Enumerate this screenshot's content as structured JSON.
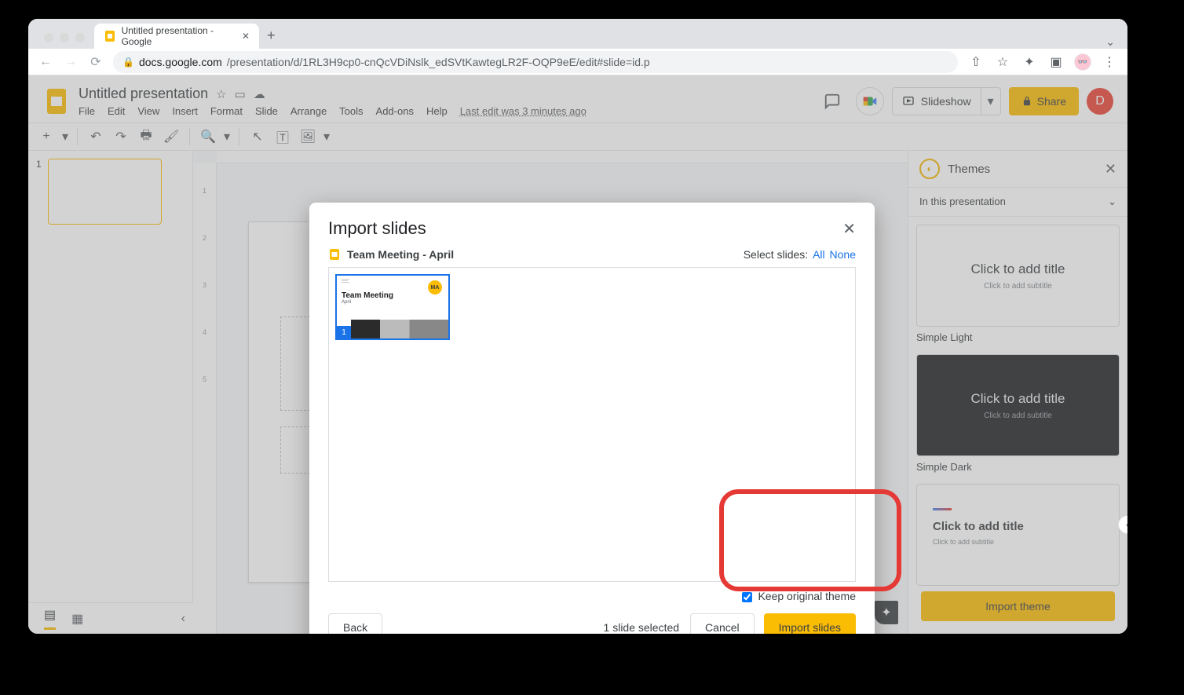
{
  "browser": {
    "tab_title": "Untitled presentation - Google",
    "url_domain": "docs.google.com",
    "url_path": "/presentation/d/1RL3H9cp0-cnQcVDiNslk_edSVtKawtegLR2F-OQP9eE/edit#slide=id.p"
  },
  "app": {
    "doc_title": "Untitled presentation",
    "menus": [
      "File",
      "Edit",
      "View",
      "Insert",
      "Format",
      "Slide",
      "Arrange",
      "Tools",
      "Add-ons",
      "Help"
    ],
    "last_edit": "Last edit was 3 minutes ago",
    "slideshow_label": "Slideshow",
    "share_label": "Share",
    "account_initial": "D"
  },
  "ruler_v": [
    "",
    "1",
    "",
    "2",
    "",
    "3",
    "",
    "4",
    "",
    "5"
  ],
  "thumbs": {
    "slide1_num": "1"
  },
  "themes": {
    "title": "Themes",
    "section": "In this presentation",
    "cards": [
      {
        "title": "Click to add title",
        "sub": "Click to add subtitle",
        "label": "Simple Light",
        "variant": "light"
      },
      {
        "title": "Click to add title",
        "sub": "Click to add subtitle",
        "label": "Simple Dark",
        "variant": "dark"
      },
      {
        "title": "Click to add title",
        "sub": "Click to add subtitle",
        "label": "",
        "variant": "left"
      }
    ],
    "import_btn": "Import theme"
  },
  "modal": {
    "title": "Import slides",
    "file_name": "Team Meeting - April",
    "select_label": "Select slides:",
    "select_all": "All",
    "select_none": "None",
    "thumb": {
      "num": "1",
      "title": "Team Meeting",
      "sub": "April",
      "badge": "MA"
    },
    "keep_theme": "Keep original theme",
    "back": "Back",
    "count": "1 slide selected",
    "cancel": "Cancel",
    "import": "Import slides"
  }
}
